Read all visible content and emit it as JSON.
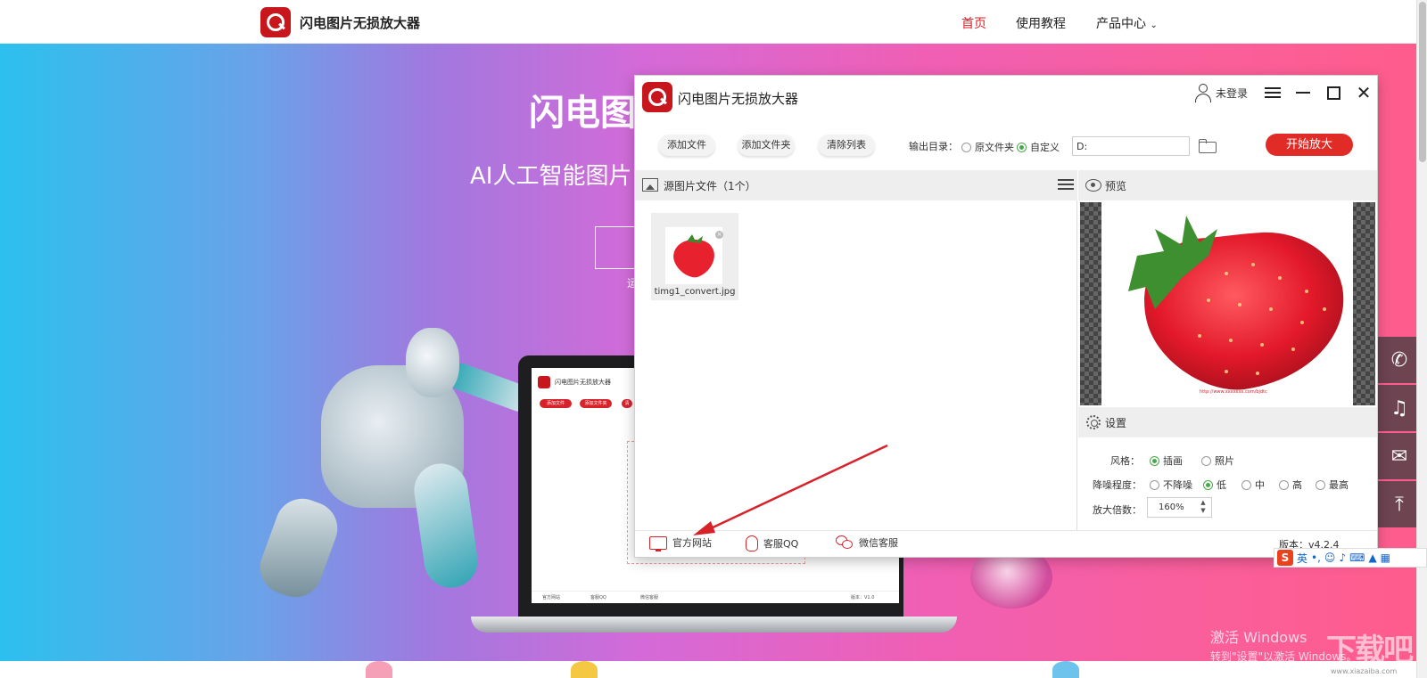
{
  "site": {
    "name": "闪电图片无损放大器",
    "nav": [
      "首页",
      "使用教程",
      "产品中心"
    ],
    "hero_title": "闪电图",
    "hero_subtitle": "AI人工智能图片",
    "hero_small": "运"
  },
  "laptop": {
    "title": "闪电图片无损放大器",
    "buttons": [
      "添加文件",
      "添加文件夹",
      "清"
    ],
    "footer": [
      "官方网站",
      "客服QQ",
      "微信客服",
      "版本：V1.0"
    ]
  },
  "app": {
    "title": "闪电图片无损放大器",
    "user_label": "未登录",
    "toolbar": {
      "add_file": "添加文件",
      "add_folder": "添加文件夹",
      "clear_list": "清除列表",
      "output_label": "输出目录：",
      "option_source": "原文件夹",
      "option_custom": "自定义",
      "output_path": "D:",
      "start": "开始放大"
    },
    "source_panel": {
      "title": "源图片文件（1个）",
      "files": [
        {
          "name": "timg1_convert.jpg"
        }
      ]
    },
    "preview": {
      "title": "预览",
      "caption": "http://www.xxxxxxx.com/bjdtc"
    },
    "settings": {
      "title": "设置",
      "style_label": "风格：",
      "style_options": [
        "插画",
        "照片"
      ],
      "noise_label": "降噪程度：",
      "noise_options": [
        "不降噪",
        "低",
        "中",
        "高",
        "最高"
      ],
      "scale_label": "放大倍数：",
      "scale_value": "160%"
    },
    "footer": {
      "website": "官方网站",
      "qq": "客服QQ",
      "wechat": "微信客服",
      "version": "版本：v4.2.4"
    }
  },
  "ime": {
    "logo": "S",
    "mode": "英"
  },
  "windows": {
    "activate_line1": "激活 Windows",
    "activate_line2": "转到\"设置\"以激活 Windows。"
  },
  "watermark": {
    "text": "下载吧",
    "url": "www.xiazaiba.com"
  },
  "colors": {
    "brand_red": "#d8222a",
    "start_button": "#e02b26",
    "radio_selected": "#4aa84a",
    "annotation_arrow": "#d8222a"
  }
}
